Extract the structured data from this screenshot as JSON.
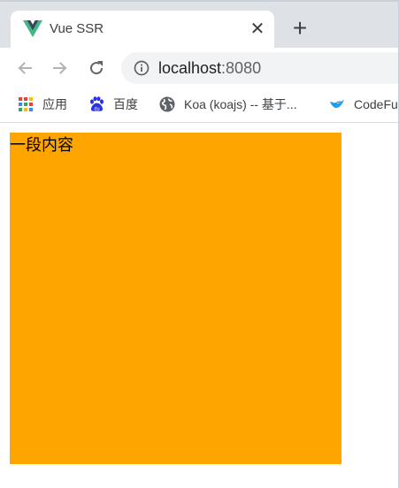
{
  "tab": {
    "title": "Vue SSR",
    "favicon": "vue-logo-icon",
    "close_label": "✕"
  },
  "new_tab_label": "+",
  "toolbar": {
    "back_icon": "arrow-left-icon",
    "forward_icon": "arrow-right-icon",
    "reload_icon": "reload-icon",
    "url_host": "localhost",
    "url_port": ":8080",
    "info_icon": "info-icon"
  },
  "bookmarks": [
    {
      "label": "应用",
      "icon": "apps-grid-icon"
    },
    {
      "label": "百度",
      "icon": "baidu-paw-icon"
    },
    {
      "label": "Koa (koajs) -- 基于...",
      "icon": "globe-icon"
    },
    {
      "label": "CodeFu",
      "icon": "bird-icon"
    }
  ],
  "page": {
    "text": "一段内容",
    "box_color": "#ffa500"
  },
  "colors": {
    "tabstrip": "#dee1e6",
    "omnibox": "#f1f3f4",
    "vue_green": "#41b883",
    "vue_dark": "#35495e"
  }
}
